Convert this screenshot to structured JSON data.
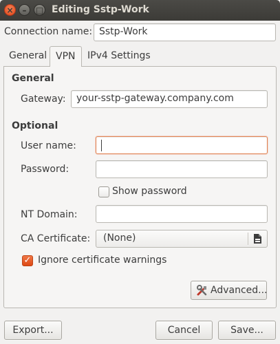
{
  "window": {
    "title": "Editing Sstp-Work",
    "close_glyph": "×",
    "minimize_glyph": "–",
    "maximize_glyph": "□"
  },
  "connection": {
    "label": "Connection name:",
    "value": "Sstp-Work"
  },
  "tabs": [
    {
      "label": "General"
    },
    {
      "label": "VPN"
    },
    {
      "label": "IPv4 Settings"
    }
  ],
  "vpn": {
    "general_header": "General",
    "gateway_label": "Gateway:",
    "gateway_value": "your-sstp-gateway.company.com",
    "optional_header": "Optional",
    "username_label": "User name:",
    "username_value": "",
    "password_label": "Password:",
    "password_value": "",
    "show_password_label": "Show password",
    "show_password_checked": false,
    "nt_domain_label": "NT Domain:",
    "nt_domain_value": "",
    "ca_cert_label": "CA Certificate:",
    "ca_cert_value": "(None)",
    "ignore_warnings_label": "Ignore certificate warnings",
    "ignore_warnings_checked": true,
    "check_glyph": "✓",
    "advanced_label": "Advanced..."
  },
  "footer": {
    "export_label": "Export...",
    "cancel_label": "Cancel",
    "save_label": "Save..."
  },
  "colors": {
    "accent": "#dd4814",
    "titlebar": "#3c3b37",
    "focus_border": "#e08555"
  },
  "icons": {
    "close": "close-icon",
    "file_chooser": "document-open-icon",
    "advanced": "tools-icon"
  }
}
